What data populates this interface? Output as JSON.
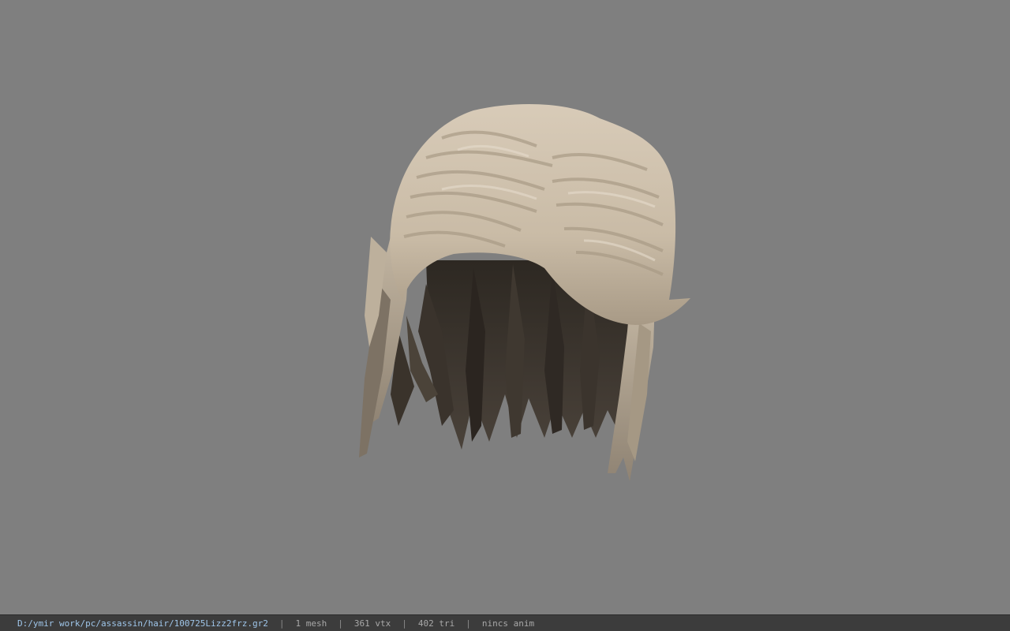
{
  "viewport": {
    "background_color": "#7f7f7f",
    "model": "hair-mesh"
  },
  "status": {
    "file_path": "D:/ymir work/pc/assassin/hair/100725Lizz2frz.gr2",
    "separator": "|",
    "mesh_count": "1 mesh",
    "vertex_count": "361 vtx",
    "triangle_count": "402 tri",
    "anim_info": "nincs anim",
    "path_color": "#9fc6ea",
    "bar_color": "#3c3c3c"
  }
}
